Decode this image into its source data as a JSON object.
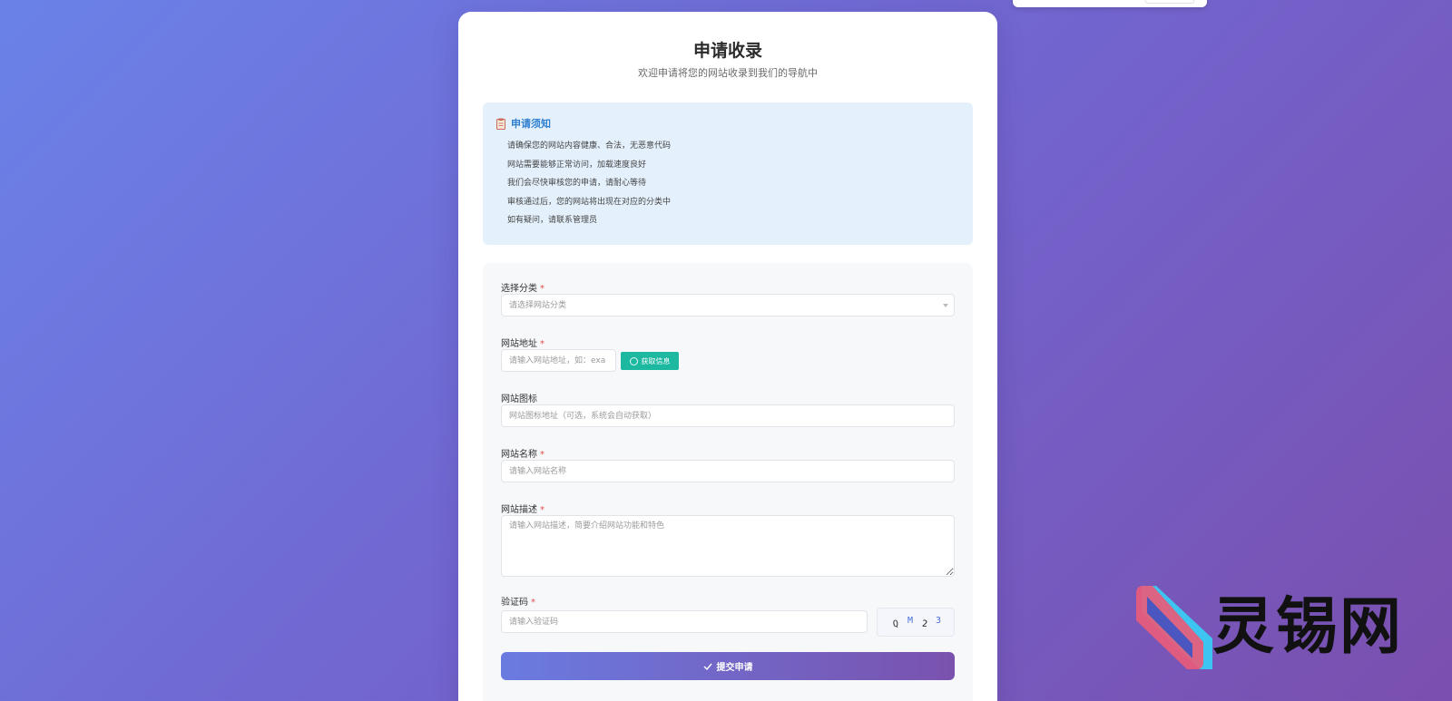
{
  "page": {
    "title": "申请收录",
    "subtitle": "欢迎申请将您的网站收录到我们的导航中"
  },
  "notice": {
    "icon": "clipboard-icon",
    "title": "申请须知",
    "items": [
      "请确保您的网站内容健康、合法，无恶意代码",
      "网站需要能够正常访问，加载速度良好",
      "我们会尽快审核您的申请，请耐心等待",
      "审核通过后，您的网站将出现在对应的分类中",
      "如有疑问，请联系管理员"
    ]
  },
  "form": {
    "required_mark": "*",
    "category": {
      "label": "选择分类",
      "placeholder": "请选择网站分类"
    },
    "url": {
      "label": "网站地址",
      "placeholder": "请输入网站地址，如：exa",
      "fetch_label": "获取信息"
    },
    "icon_url": {
      "label": "网站图标",
      "placeholder": "网站图标地址（可选，系统会自动获取）"
    },
    "name": {
      "label": "网站名称",
      "placeholder": "请输入网站名称"
    },
    "description": {
      "label": "网站描述",
      "placeholder": "请输入网站描述，简要介绍网站功能和特色"
    },
    "captcha": {
      "label": "验证码",
      "placeholder": "请输入验证码",
      "chars": [
        "Q",
        "M",
        "2",
        "3"
      ]
    },
    "submit_label": "提交申请"
  },
  "watermark": {
    "text": "灵锡网"
  },
  "colors": {
    "accent_blue": "#2f7fd0",
    "fetch_button": "#1cb8a0",
    "required": "#e54d4d",
    "gradient_start": "#6a7be0",
    "gradient_end": "#7a52ae"
  }
}
